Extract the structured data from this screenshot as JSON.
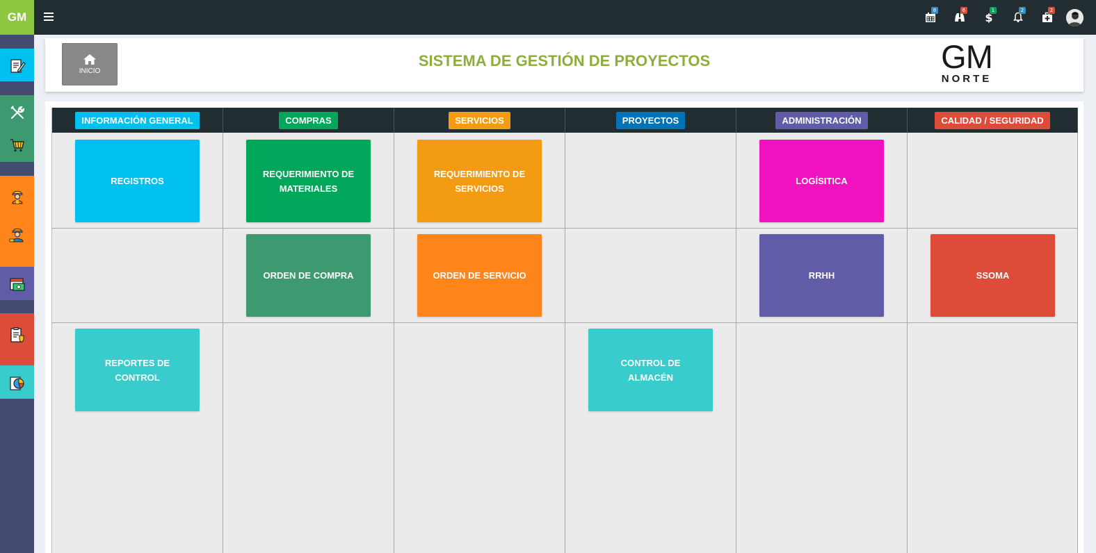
{
  "brand": {
    "text": "GM",
    "color": "#8dc63f"
  },
  "topbar": {
    "menu_icon": "hamburger-icon",
    "notifications": [
      {
        "icon": "calendar-icon",
        "count": "8",
        "badge_color": "#3c8dbc"
      },
      {
        "icon": "binoculars-icon",
        "count": "6",
        "badge_color": "#dd4b39"
      },
      {
        "icon": "dollar-icon",
        "count": "1",
        "badge_color": "#00a65a"
      },
      {
        "icon": "bell-icon",
        "count": "2",
        "badge_color": "#3c8dbc"
      },
      {
        "icon": "medkit-icon",
        "count": "2",
        "badge_color": "#dd4b39"
      }
    ],
    "avatar_icon": "user-avatar"
  },
  "sidebar": {
    "items": [
      {
        "icon": "edit-document-icon",
        "color": "#00c0ef"
      },
      {
        "icon": "tools-icon",
        "color": "#3d9970"
      },
      {
        "icon": "cart-icon",
        "color": "#3d9970"
      },
      {
        "icon": "worker-icon",
        "color": "#ff851b"
      },
      {
        "icon": "engineer-icon",
        "color": "#ff851b"
      },
      {
        "icon": "calendar-money-icon",
        "color": "#605ca8"
      },
      {
        "icon": "clipboard-shield-icon",
        "color": "#dd4b39"
      },
      {
        "icon": "pie-chart-icon",
        "color": "#39cccc"
      }
    ]
  },
  "header": {
    "home_button": {
      "label": "INICIO",
      "icon": "home-icon"
    },
    "title": "SISTEMA DE GESTIÓN DE PROYECTOS",
    "logo": {
      "big": "GM",
      "small": "NORTE"
    }
  },
  "columns": [
    {
      "label": "INFORMACIÓN GENERAL",
      "color": "#00c0ef"
    },
    {
      "label": "COMPRAS",
      "color": "#00a65a"
    },
    {
      "label": "SERVICIOS",
      "color": "#f39c12"
    },
    {
      "label": "PROYECTOS",
      "color": "#0073b7"
    },
    {
      "label": "ADMINISTRACIÓN",
      "color": "#605ca8"
    },
    {
      "label": "CALIDAD / SEGURIDAD",
      "color": "#dd4b39"
    }
  ],
  "tiles": [
    {
      "label": "REGISTROS",
      "color": "#00c0ef",
      "column": 0,
      "row": 0
    },
    {
      "label": "REQUERIMIENTO DE MATERIALES",
      "color": "#00a65a",
      "column": 1,
      "row": 0
    },
    {
      "label": "REQUERIMIENTO DE SERVICIOS",
      "color": "#f39c12",
      "column": 2,
      "row": 0
    },
    {
      "label": "LOGÍSITICA",
      "color": "#f012be",
      "column": 4,
      "row": 0
    },
    {
      "label": "ORDEN DE COMPRA",
      "color": "#3d9970",
      "column": 1,
      "row": 1
    },
    {
      "label": "ORDEN DE SERVICIO",
      "color": "#ff851b",
      "column": 2,
      "row": 1
    },
    {
      "label": "RRHH",
      "color": "#605ca8",
      "column": 4,
      "row": 1
    },
    {
      "label": "SSOMA",
      "color": "#dd4b39",
      "column": 5,
      "row": 1
    },
    {
      "label": "REPORTES DE CONTROL",
      "color": "#39cccc",
      "column": 0,
      "row": 2
    },
    {
      "label": "CONTROL DE ALMACÉN",
      "color": "#39cccc",
      "column": 3,
      "row": 2
    }
  ]
}
